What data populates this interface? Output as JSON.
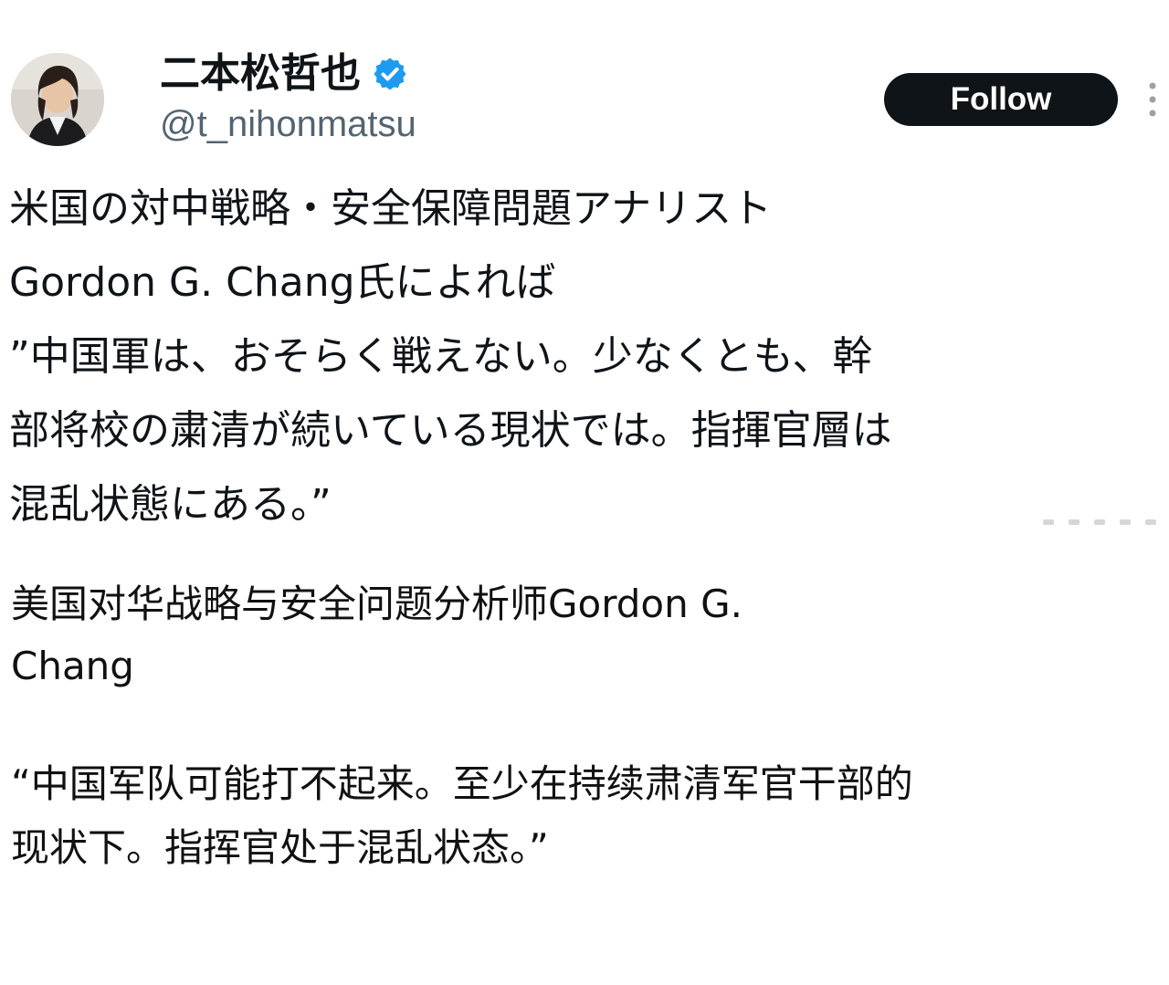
{
  "tweet": {
    "author": {
      "display_name": "二本松哲也",
      "handle": "@t_nihonmatsu",
      "verified": true,
      "avatar_icon": "profile-photo"
    },
    "follow_label": "Follow",
    "more_icon": "more-vertical-icon",
    "text_lines": [
      "米国の対中戦略・安全保障問題アナリスト",
      "Gordon G. Chang氏によれば",
      "”中国軍は、おそらく戦えない。少なくとも、幹",
      "部将校の粛清が続いている現状では。指揮官層は",
      "混乱状態にある。”"
    ]
  },
  "translation": {
    "intro_lines": [
      "美国对华战略与安全问题分析师Gordon G.",
      "Chang"
    ],
    "quote_lines": [
      " “中国军队可能打不起来。至少在持续肃清军官干部的",
      "现状下。指挥官处于混乱状态。”"
    ]
  },
  "colors": {
    "text_primary": "#0f1419",
    "text_secondary": "#536471",
    "follow_bg": "#0f1419",
    "follow_text": "#ffffff",
    "verified_blue": "#1d9bf0"
  }
}
